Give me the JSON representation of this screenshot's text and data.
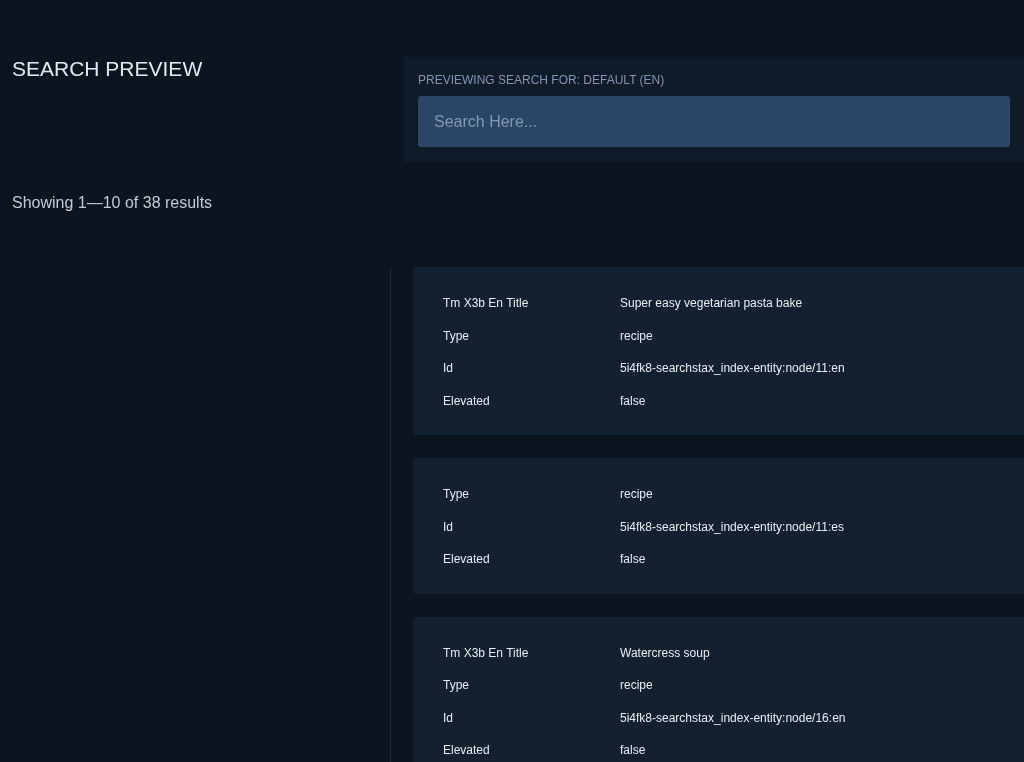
{
  "title": "SEARCH PREVIEW",
  "search": {
    "label": "PREVIEWING SEARCH FOR: DEFAULT (EN)",
    "placeholder": "Search Here..."
  },
  "summary": "Showing 1—10 of 38 results",
  "results": [
    {
      "fields": [
        {
          "name": "Tm X3b En Title",
          "value": "Super easy vegetarian pasta bake"
        },
        {
          "name": "Type",
          "value": "recipe"
        },
        {
          "name": "Id",
          "value": "5i4fk8-searchstax_index-entity:node/11:en"
        },
        {
          "name": "Elevated",
          "value": "false"
        }
      ]
    },
    {
      "fields": [
        {
          "name": "Type",
          "value": "recipe"
        },
        {
          "name": "Id",
          "value": "5i4fk8-searchstax_index-entity:node/11:es"
        },
        {
          "name": "Elevated",
          "value": "false"
        }
      ]
    },
    {
      "fields": [
        {
          "name": "Tm X3b En Title",
          "value": "Watercress soup"
        },
        {
          "name": "Type",
          "value": "recipe"
        },
        {
          "name": "Id",
          "value": "5i4fk8-searchstax_index-entity:node/16:en"
        },
        {
          "name": "Elevated",
          "value": "false"
        }
      ]
    }
  ]
}
